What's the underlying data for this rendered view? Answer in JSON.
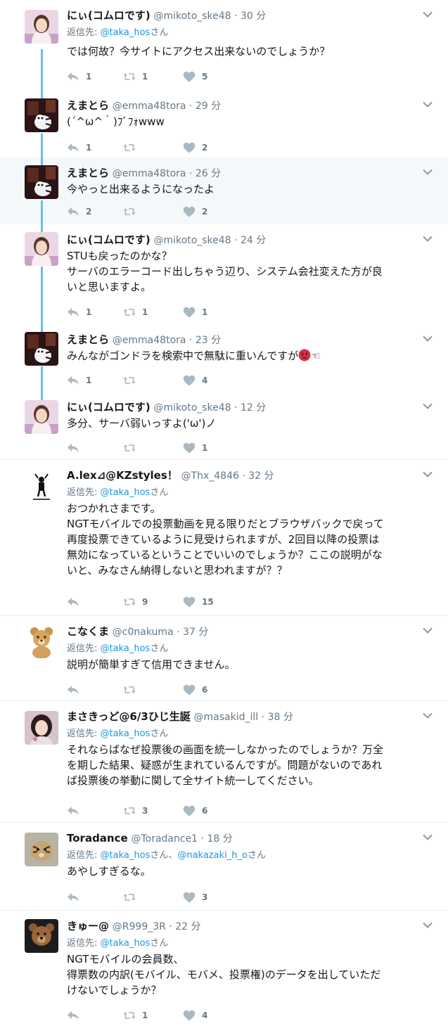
{
  "reply_prefix": "返信先: ",
  "colors": {
    "accent": "#1b95e0",
    "thread": "#6cbfde",
    "muted": "#657786",
    "text": "#14171a"
  },
  "tweets": [
    {
      "name": "にぃ(コムロです)",
      "handle": "@mikoto_ske48",
      "time": "30 分",
      "reply_to": [
        "@taka_hos"
      ],
      "reply_suffix": "さん",
      "lines": [
        "では何故？今サイトにアクセス出来ないのでしょうか？"
      ],
      "counts": {
        "reply": "1",
        "retweet": "1",
        "like": "5"
      },
      "avatar": "woman-avatar"
    },
    {
      "name": "えまとら",
      "handle": "@emma48tora",
      "time": "29 分",
      "lines": [
        "(´^ω^｀)ﾌﾞﾌｫwww"
      ],
      "counts": {
        "reply": "1",
        "retweet": "",
        "like": "2"
      },
      "avatar": "tiger-plush-avatar"
    },
    {
      "name": "えまとら",
      "handle": "@emma48tora",
      "time": "26 分",
      "lines": [
        "今やっと出来るようになったよ"
      ],
      "counts": {
        "reply": "2",
        "retweet": "",
        "like": "2"
      },
      "avatar": "tiger-plush-avatar"
    },
    {
      "name": "にぃ(コムロです)",
      "handle": "@mikoto_ske48",
      "time": "24 分",
      "lines": [
        "STUも戻ったのかな？",
        "サーバのエラーコード出しちゃう辺り、システム会社変えた方が良",
        "いと思いますよ。"
      ],
      "counts": {
        "reply": "1",
        "retweet": "1",
        "like": "1"
      },
      "avatar": "woman-avatar"
    },
    {
      "name": "えまとら",
      "handle": "@emma48tora",
      "time": "23 分",
      "lines": [
        "みんながゴンドラを検索中で無駄に重いんですが"
      ],
      "trailing_glyph": "☜",
      "counts": {
        "reply": "1",
        "retweet": "",
        "like": "4"
      },
      "avatar": "tiger-plush-avatar"
    },
    {
      "name": "にぃ(コムロです)",
      "handle": "@mikoto_ske48",
      "time": "12 分",
      "lines": [
        "多分、サーバ弱いっすよ('ω')ノ"
      ],
      "counts": {
        "reply": "",
        "retweet": "",
        "like": "1"
      },
      "avatar": "woman-avatar"
    },
    {
      "name": "A.lex⊿@KZstyles！",
      "handle": "@Thx_4846",
      "time": "32 分",
      "reply_to": [
        "@taka_hos"
      ],
      "reply_suffix": "さん",
      "lines": [
        "おつかれさまです。",
        "NGTモバイルでの投票動画を見る限りだとブラウザバックで戻って",
        "再度投票できているように見受けられますが、2回目以降の投票は",
        "無効になっているということでいいのでしょうか？ここの説明がな",
        "いと、みなさん納得しないと思われますが？？"
      ],
      "counts": {
        "reply": "",
        "retweet": "9",
        "like": "15"
      },
      "avatar": "logo-avatar"
    },
    {
      "name": "こなくま",
      "handle": "@c0nakuma",
      "time": "37 分",
      "reply_to": [
        "@taka_hos"
      ],
      "reply_suffix": "さん",
      "lines": [
        "説明が簡単すぎて信用できません。"
      ],
      "counts": {
        "reply": "",
        "retweet": "",
        "like": "6"
      },
      "avatar": "teddy-bear-avatar"
    },
    {
      "name": "まさきっど@6/3ひじ生誕",
      "handle": "@masakid_ill",
      "time": "38 分",
      "reply_to": [
        "@taka_hos"
      ],
      "reply_suffix": "さん",
      "lines": [
        "それならばなぜ投票後の画面を統一しなかったのでしょうか？万全",
        "を期した結果、疑惑が生まれているんですが。問題がないのであれ",
        "ば投票後の挙動に関して全サイト統一してください。"
      ],
      "counts": {
        "reply": "",
        "retweet": "3",
        "like": "6"
      },
      "avatar": "girl-avatar"
    },
    {
      "name": "Toradance",
      "handle": "@Toradance1",
      "time": "18 分",
      "reply_to": [
        "@taka_hos",
        "@nakazaki_h_o"
      ],
      "reply_suffix": "さん",
      "reply_joiner": "さん、",
      "lines": [
        "あやしすぎるな。"
      ],
      "counts": {
        "reply": "",
        "retweet": "",
        "like": "3"
      },
      "avatar": "tiger-avatar"
    },
    {
      "name": "きゅー@",
      "handle": "@R999_3R",
      "time": "22 分",
      "reply_to": [
        "@taka_hos"
      ],
      "reply_suffix": "さん",
      "lines": [
        "NGTモバイルの会員数、",
        "得票数の内訳(モバイル、モバメ、投票権)のデータを出していただ",
        "けないでしょうか？"
      ],
      "counts": {
        "reply": "",
        "retweet": "1",
        "like": "4"
      },
      "avatar": "bear-plush-avatar"
    }
  ]
}
